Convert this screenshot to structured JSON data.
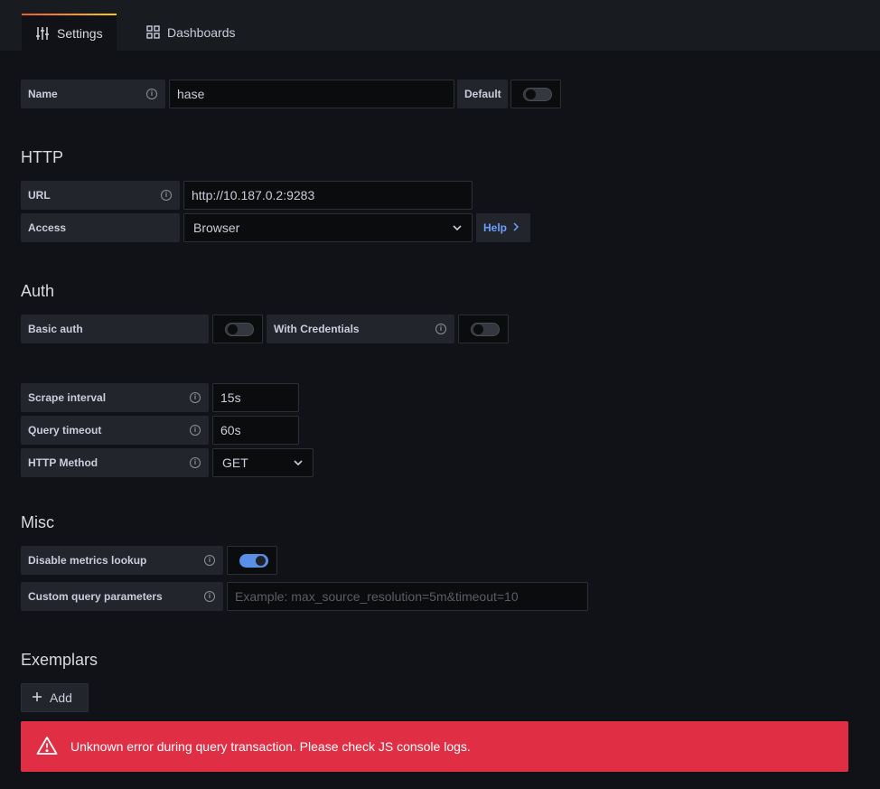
{
  "tabs": [
    {
      "label": "Settings",
      "icon": "sliders-icon",
      "active": true
    },
    {
      "label": "Dashboards",
      "icon": "apps-grid-icon",
      "active": false
    }
  ],
  "name_row": {
    "label": "Name",
    "value": "hase",
    "default_label": "Default",
    "default_on": false
  },
  "http": {
    "title": "HTTP",
    "url_label": "URL",
    "url_value": "http://10.187.0.2:9283",
    "access_label": "Access",
    "access_value": "Browser",
    "help_label": "Help"
  },
  "auth": {
    "title": "Auth",
    "basic_auth_label": "Basic auth",
    "basic_auth_on": false,
    "with_credentials_label": "With Credentials",
    "with_credentials_on": false
  },
  "prometheus": {
    "scrape_interval_label": "Scrape interval",
    "scrape_interval_value": "15s",
    "query_timeout_label": "Query timeout",
    "query_timeout_value": "60s",
    "http_method_label": "HTTP Method",
    "http_method_value": "GET"
  },
  "misc": {
    "title": "Misc",
    "disable_metrics_label": "Disable metrics lookup",
    "disable_metrics_on": true,
    "custom_params_label": "Custom query parameters",
    "custom_params_placeholder": "Example: max_source_resolution=5m&timeout=10"
  },
  "exemplars": {
    "title": "Exemplars",
    "add_label": "Add"
  },
  "alert": {
    "message": "Unknown error during query transaction. Please check JS console logs."
  },
  "colors": {
    "error": "#e02f44",
    "toggle_on": "#5a8fe6",
    "link": "#6e9fff"
  }
}
